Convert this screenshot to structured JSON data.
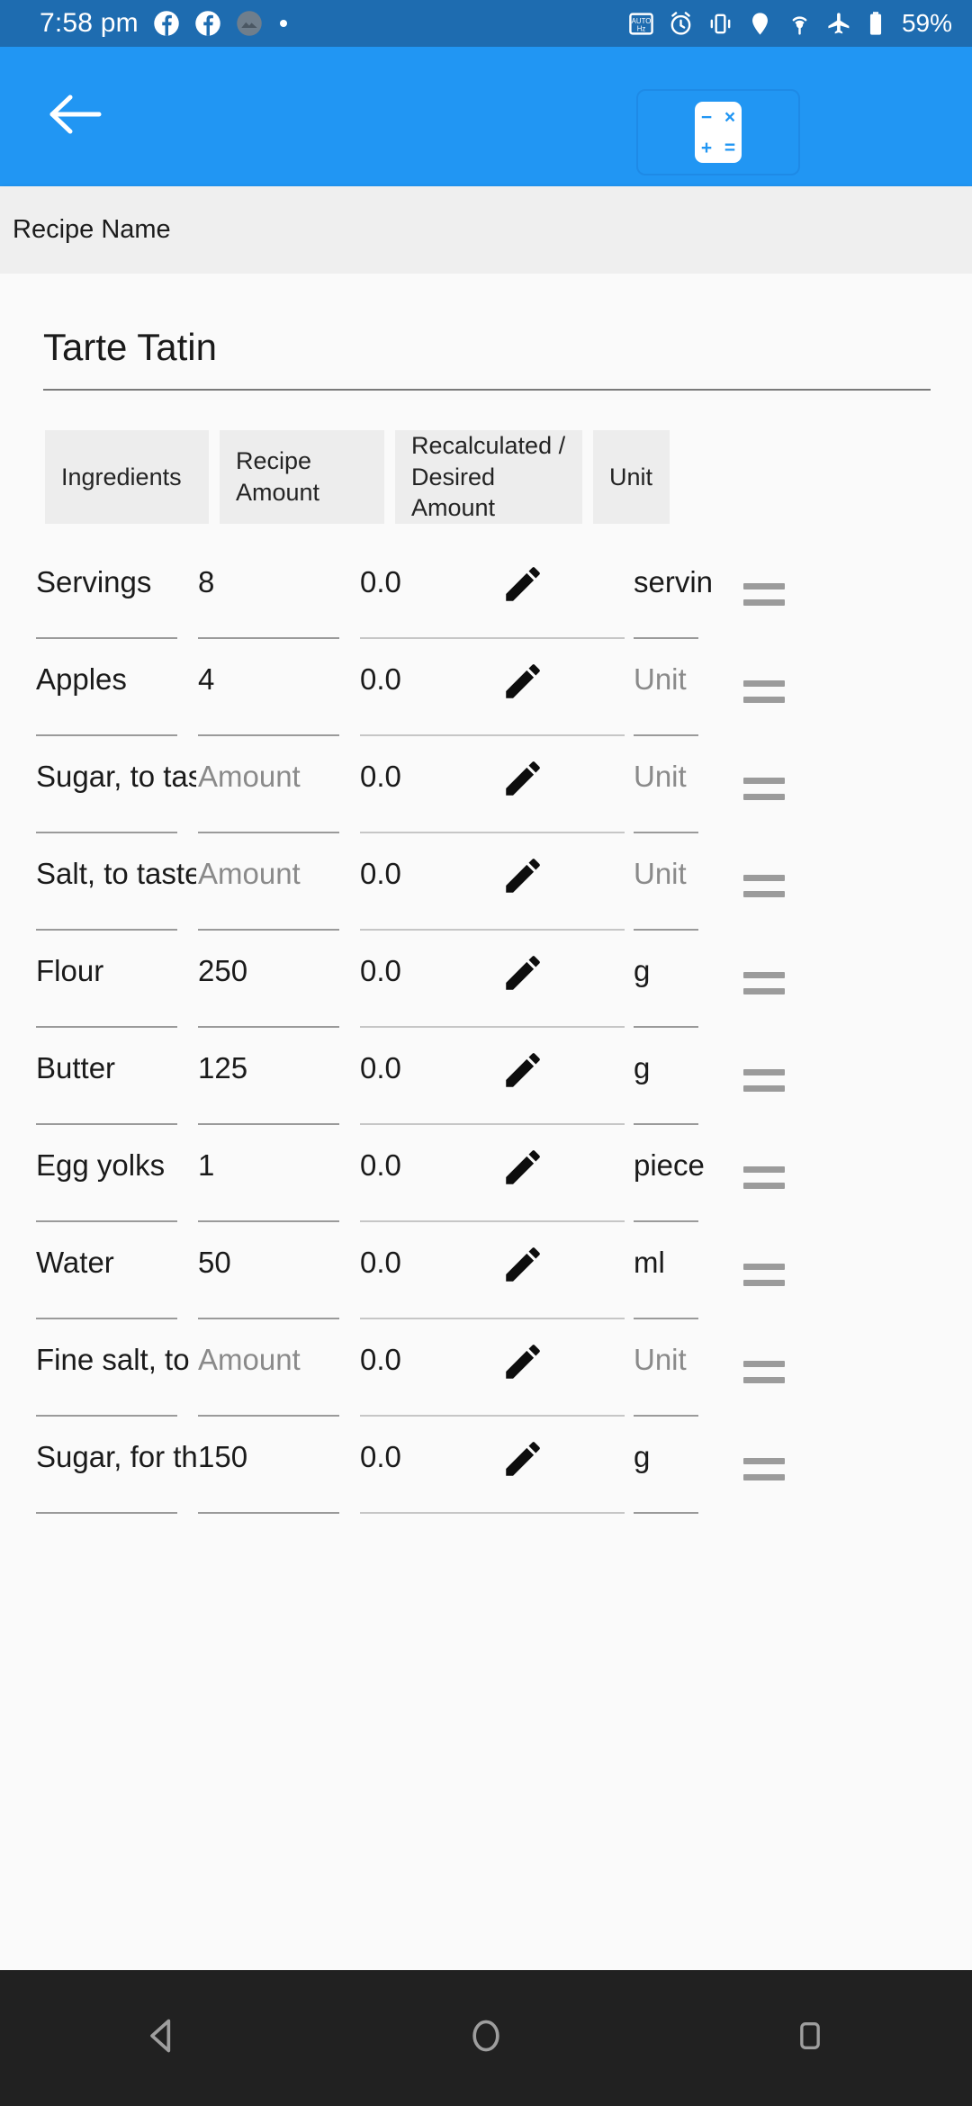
{
  "status_bar": {
    "time": "7:58 pm",
    "battery_percent": "59%",
    "left_icons": [
      "facebook-icon",
      "facebook-icon",
      "avatar-icon",
      "dot-icon"
    ],
    "right_icons": [
      "auto-hz-icon",
      "alarm-icon",
      "vibrate-icon",
      "location-icon",
      "hotspot-icon",
      "airplane-mode-icon",
      "battery-icon"
    ],
    "background": "#1E6CB0"
  },
  "app_bar": {
    "background": "#2196F3",
    "back_icon": "arrow-left-icon",
    "calculator_button": {
      "icon": "calculator-icon",
      "symbols": [
        "−",
        "×",
        "+",
        "="
      ]
    }
  },
  "name_band": {
    "label": "Recipe Name",
    "background": "#EFEFEF"
  },
  "recipe": {
    "title": "Tarte Tatin"
  },
  "table": {
    "headers": {
      "ingredients": "Ingredients",
      "recipe_amount": "Recipe Amount",
      "recalculated": "Recalculated / Desired Amount",
      "unit": "Unit"
    },
    "placeholders": {
      "amount": "Amount",
      "unit": "Unit"
    },
    "rows": [
      {
        "ingredient": "Servings",
        "amount": "8",
        "amount_is_placeholder": false,
        "recalculated": "0.0",
        "unit": "servin",
        "unit_is_placeholder": false
      },
      {
        "ingredient": "Apples",
        "amount": "4",
        "amount_is_placeholder": false,
        "recalculated": "0.0",
        "unit": "Unit",
        "unit_is_placeholder": true
      },
      {
        "ingredient": "Sugar, to taste",
        "amount": "Amount",
        "amount_is_placeholder": true,
        "recalculated": "0.0",
        "unit": "Unit",
        "unit_is_placeholder": true
      },
      {
        "ingredient": "Salt, to taste",
        "amount": "Amount",
        "amount_is_placeholder": true,
        "recalculated": "0.0",
        "unit": "Unit",
        "unit_is_placeholder": true
      },
      {
        "ingredient": "Flour",
        "amount": "250",
        "amount_is_placeholder": false,
        "recalculated": "0.0",
        "unit": "g",
        "unit_is_placeholder": false
      },
      {
        "ingredient": "Butter",
        "amount": "125",
        "amount_is_placeholder": false,
        "recalculated": "0.0",
        "unit": "g",
        "unit_is_placeholder": false
      },
      {
        "ingredient": "Egg yolks",
        "amount": "1",
        "amount_is_placeholder": false,
        "recalculated": "0.0",
        "unit": "piece",
        "unit_is_placeholder": false
      },
      {
        "ingredient": "Water",
        "amount": "50",
        "amount_is_placeholder": false,
        "recalculated": "0.0",
        "unit": "ml",
        "unit_is_placeholder": false
      },
      {
        "ingredient": "Fine salt, to taste",
        "amount": "Amount",
        "amount_is_placeholder": true,
        "recalculated": "0.0",
        "unit": "Unit",
        "unit_is_placeholder": true
      },
      {
        "ingredient": "Sugar, for the caramel",
        "amount": "150",
        "amount_is_placeholder": false,
        "recalculated": "0.0",
        "unit": "g",
        "unit_is_placeholder": false
      }
    ],
    "row_icons": {
      "edit": "pencil-icon",
      "drag": "drag-handle-icon"
    }
  },
  "nav_bar": {
    "background": "#212121",
    "items": [
      {
        "name": "back-nav-button",
        "icon": "triangle-back-icon"
      },
      {
        "name": "home-nav-button",
        "icon": "circle-home-icon"
      },
      {
        "name": "recents-nav-button",
        "icon": "square-recents-icon"
      }
    ]
  }
}
